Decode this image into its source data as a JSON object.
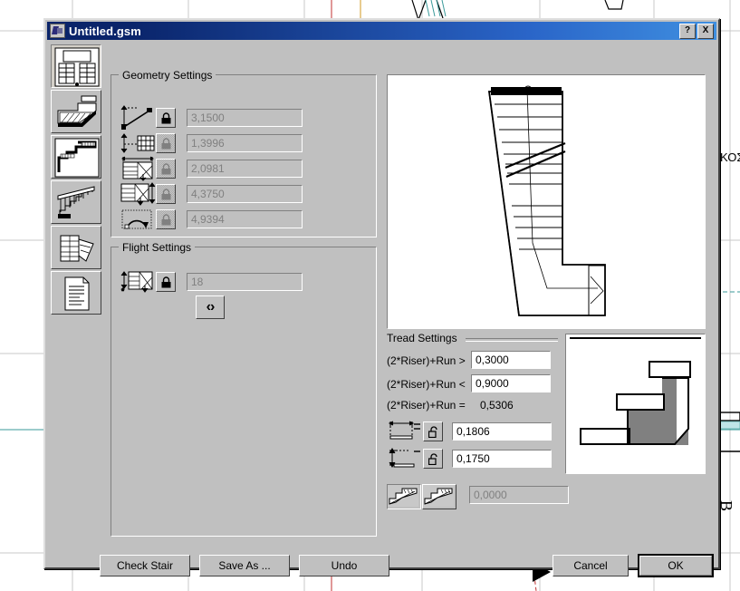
{
  "window": {
    "title": "Untitled.gsm",
    "icon": "stair-tool-icon",
    "help_button": "?",
    "close_button": "X"
  },
  "sidebar": {
    "items": [
      {
        "name": "plan-view-tab",
        "icon": "stair-plan-icon",
        "selected": true
      },
      {
        "name": "section-view-tab",
        "icon": "stair-section-icon",
        "selected": false
      },
      {
        "name": "structure-tab",
        "icon": "stair-structure-icon",
        "selected": false
      },
      {
        "name": "railing-tab",
        "icon": "stair-railing-icon",
        "selected": false
      },
      {
        "name": "tread-detail-tab",
        "icon": "stair-tread-icon",
        "selected": false
      },
      {
        "name": "listing-tab",
        "icon": "document-list-icon",
        "selected": false
      }
    ]
  },
  "geometry": {
    "title": "Geometry Settings",
    "rows": [
      {
        "icon": "stair-height-icon",
        "lock": "locked",
        "lock_enabled": true,
        "value": "3,1500",
        "enabled": false
      },
      {
        "icon": "stair-riser-count-icon",
        "lock": "locked",
        "lock_enabled": false,
        "value": "1,3996",
        "enabled": false
      },
      {
        "icon": "stair-width-icon",
        "lock": "locked",
        "lock_enabled": false,
        "value": "2,0981",
        "enabled": false
      },
      {
        "icon": "stair-length-icon",
        "lock": "locked",
        "lock_enabled": false,
        "value": "4,3750",
        "enabled": false
      },
      {
        "icon": "stair-rotation-icon",
        "lock": "locked",
        "lock_enabled": false,
        "value": "4,9394",
        "enabled": false
      }
    ]
  },
  "flight": {
    "title": "Flight Settings",
    "icon": "flight-count-icon",
    "lock": "locked",
    "lock_enabled": true,
    "value": "18",
    "enabled": false,
    "stepper_label": "‹›"
  },
  "tread": {
    "title": "Tread Settings",
    "formula_rows": [
      {
        "label": "(2*Riser)+Run >",
        "value": "0,3000",
        "readonly": false
      },
      {
        "label": "(2*Riser)+Run <",
        "value": "0,9000",
        "readonly": false
      },
      {
        "label": "(2*Riser)+Run =",
        "value": "0,5306",
        "readonly": true
      }
    ],
    "dimension_rows": [
      {
        "icon": "run-dimension-icon",
        "lock": "unlocked",
        "value": "0,1806",
        "enabled": true
      },
      {
        "icon": "riser-dimension-icon",
        "lock": "unlocked",
        "value": "0,1750",
        "enabled": true
      }
    ],
    "nosing": {
      "toggle_a": {
        "icon": "tread-nosing-a-icon",
        "pressed": true
      },
      "toggle_b": {
        "icon": "tread-nosing-b-icon",
        "pressed": false
      },
      "value": "0,0000",
      "enabled": false
    }
  },
  "previews": {
    "plan": "stair-plan-preview",
    "detail": "stair-tread-detail-preview"
  },
  "buttons": {
    "check_stair": "Check Stair",
    "save_as": "Save As ...",
    "undo": "Undo",
    "cancel": "Cancel",
    "ok": "OK"
  },
  "background": {
    "label_right": "ΚΟΣ",
    "label_corner": "B"
  },
  "colors": {
    "title_bar_start": "#0a246a",
    "title_bar_end": "#3f8fe0",
    "dialog_face": "#c0c0c0",
    "field_disabled_text": "#808080",
    "detail_fill": "#808080",
    "cad_red": "#c03030",
    "cad_orange": "#d09a20",
    "cad_teal": "#3a9a9a"
  }
}
